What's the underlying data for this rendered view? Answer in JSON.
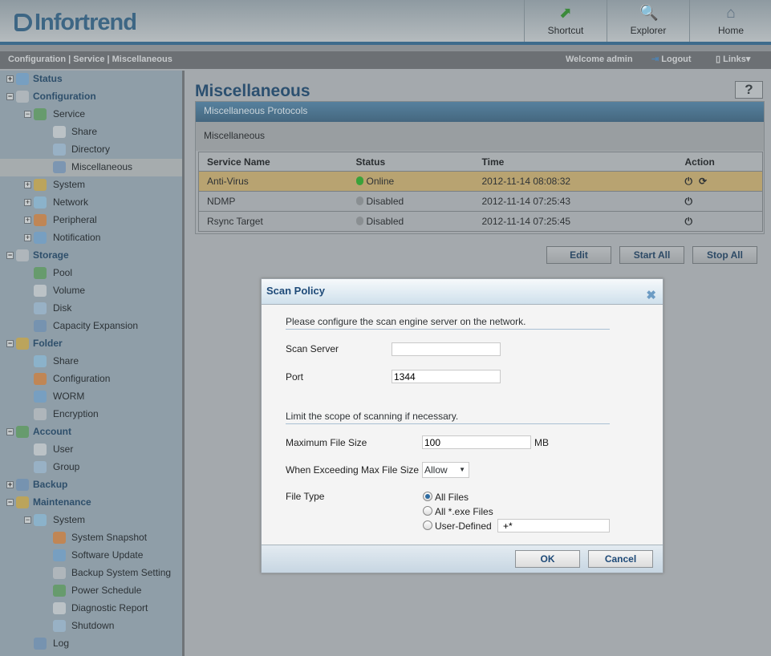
{
  "header": {
    "logo": "Infortrend",
    "nav": [
      {
        "label": "Shortcut",
        "icon": "shortcut-icon"
      },
      {
        "label": "Explorer",
        "icon": "explorer-icon"
      },
      {
        "label": "Home",
        "icon": "home-icon"
      }
    ]
  },
  "bar": {
    "breadcrumb": "Configuration | Service | Miscellaneous",
    "welcome": "Welcome admin",
    "logout": "Logout",
    "links": "Links▾"
  },
  "sidebar": [
    {
      "label": "Status",
      "level": 0,
      "exp": "+"
    },
    {
      "label": "Configuration",
      "level": 0,
      "exp": "-"
    },
    {
      "label": "Service",
      "level": 1,
      "exp": "-"
    },
    {
      "label": "Share",
      "level": 2
    },
    {
      "label": "Directory",
      "level": 2
    },
    {
      "label": "Miscellaneous",
      "level": 2,
      "selected": true
    },
    {
      "label": "System",
      "level": 1,
      "exp": "+"
    },
    {
      "label": "Network",
      "level": 1,
      "exp": "+"
    },
    {
      "label": "Peripheral",
      "level": 1,
      "exp": "+"
    },
    {
      "label": "Notification",
      "level": 1,
      "exp": "+"
    },
    {
      "label": "Storage",
      "level": 0,
      "exp": "-"
    },
    {
      "label": "Pool",
      "level": 1
    },
    {
      "label": "Volume",
      "level": 1
    },
    {
      "label": "Disk",
      "level": 1
    },
    {
      "label": "Capacity Expansion",
      "level": 1
    },
    {
      "label": "Folder",
      "level": 0,
      "exp": "-"
    },
    {
      "label": "Share",
      "level": 1
    },
    {
      "label": "Configuration",
      "level": 1
    },
    {
      "label": "WORM",
      "level": 1
    },
    {
      "label": "Encryption",
      "level": 1
    },
    {
      "label": "Account",
      "level": 0,
      "exp": "-"
    },
    {
      "label": "User",
      "level": 1
    },
    {
      "label": "Group",
      "level": 1
    },
    {
      "label": "Backup",
      "level": 0,
      "exp": "+"
    },
    {
      "label": "Maintenance",
      "level": 0,
      "exp": "-"
    },
    {
      "label": "System",
      "level": 1,
      "exp": "-"
    },
    {
      "label": "System Snapshot",
      "level": 2
    },
    {
      "label": "Software Update",
      "level": 2
    },
    {
      "label": "Backup System Setting",
      "level": 2
    },
    {
      "label": "Power Schedule",
      "level": 2
    },
    {
      "label": "Diagnostic Report",
      "level": 2
    },
    {
      "label": "Shutdown",
      "level": 2
    },
    {
      "label": "Log",
      "level": 1
    }
  ],
  "main": {
    "title": "Miscellaneous",
    "help": "?",
    "panel_title": "Miscellaneous Protocols",
    "panel_sub": "Miscellaneous",
    "columns": [
      "Service Name",
      "Status",
      "Time",
      "Action"
    ],
    "rows": [
      {
        "name": "Anti-Virus",
        "status": "Online",
        "status_color": "#3aa23a",
        "time": "2012-11-14 08:08:32",
        "actions": [
          "power-icon",
          "refresh-icon"
        ],
        "highlight": true
      },
      {
        "name": "NDMP",
        "status": "Disabled",
        "status_color": "#8a8f92",
        "time": "2012-11-14 07:25:43",
        "actions": [
          "power-icon"
        ]
      },
      {
        "name": "Rsync Target",
        "status": "Disabled",
        "status_color": "#8a8f92",
        "time": "2012-11-14 07:25:45",
        "actions": [
          "power-icon"
        ]
      }
    ],
    "buttons": {
      "edit": "Edit",
      "start_all": "Start All",
      "stop_all": "Stop All"
    }
  },
  "dialog": {
    "title": "Scan Policy",
    "intro": "Please configure the scan engine server on the network.",
    "scan_server_label": "Scan Server",
    "scan_server_value": "",
    "port_label": "Port",
    "port_value": "1344",
    "limit_text": "Limit the scope of scanning if necessary.",
    "max_size_label": "Maximum File Size",
    "max_size_value": "100",
    "max_size_unit": "MB",
    "exceed_label": "When Exceeding Max File Size",
    "exceed_value": "Allow",
    "file_type_label": "File Type",
    "file_types": [
      {
        "label": "All Files",
        "checked": true
      },
      {
        "label": "All *.exe Files",
        "checked": false
      },
      {
        "label": "User-Defined",
        "checked": false
      }
    ],
    "user_defined_value": "+*",
    "ok": "OK",
    "cancel": "Cancel"
  }
}
